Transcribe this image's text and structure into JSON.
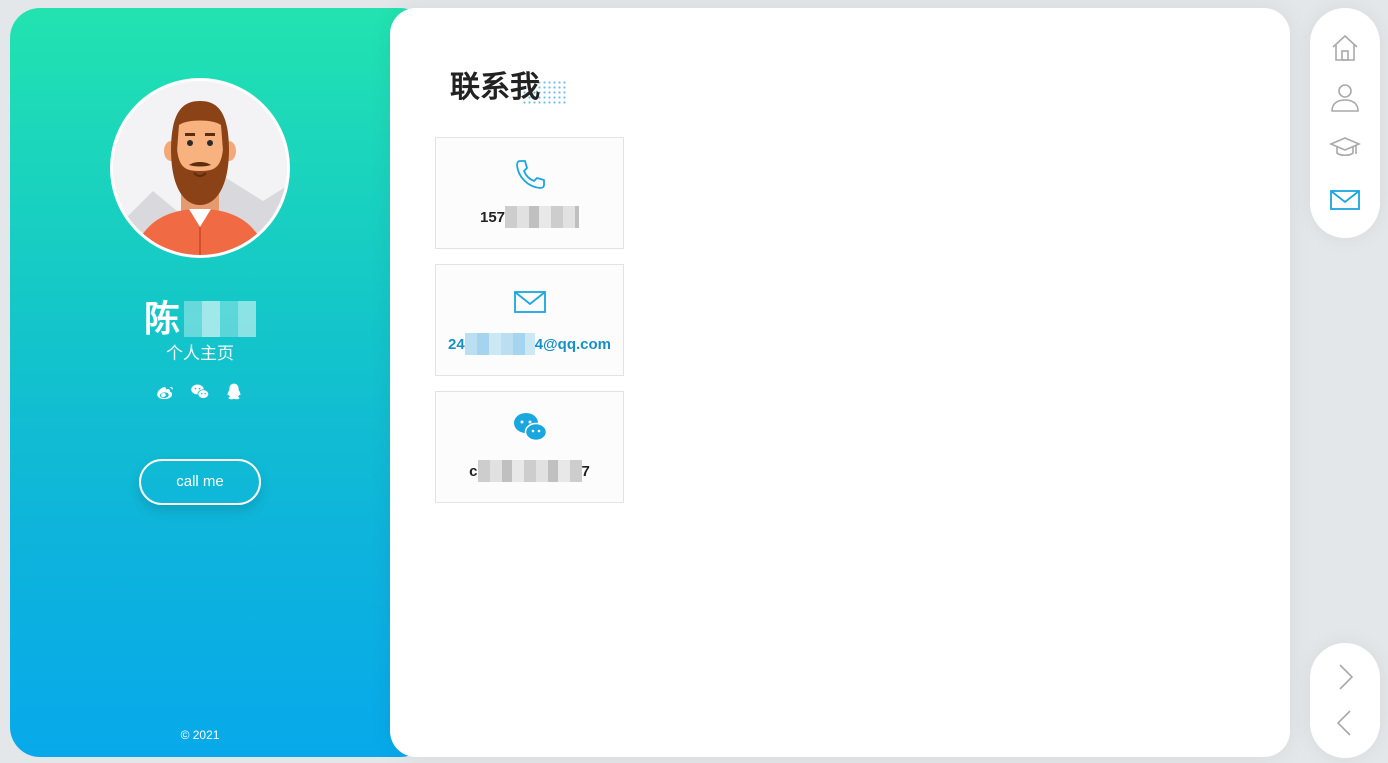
{
  "profile": {
    "name_visible": "陈",
    "subtitle": "个人主页",
    "call_button": "call me",
    "copyright": "© 2021",
    "socials": [
      "weibo-icon",
      "wechat-icon",
      "qq-icon"
    ]
  },
  "contact": {
    "title": "联系我",
    "phone_prefix": "157",
    "email_prefix": "24",
    "email_suffix": "4@qq.com",
    "wechat_prefix": "c",
    "wechat_suffix": "7"
  },
  "nav": {
    "items": [
      "home-icon",
      "user-icon",
      "graduation-cap-icon",
      "mail-icon"
    ],
    "active": "mail-icon"
  },
  "colors": {
    "gradient_top": "#22e3b0",
    "gradient_bottom": "#07a9ea",
    "accent": "#1aa6df",
    "nav_icon": "#a9a9a9"
  }
}
